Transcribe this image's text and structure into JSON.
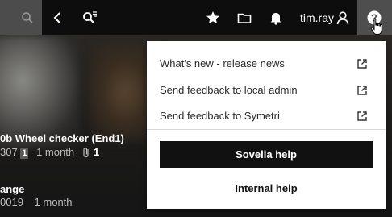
{
  "topbar": {
    "username": "tim.ray"
  },
  "icons": {
    "search": "search-icon",
    "back": "chevron-left-icon",
    "advanced_search": "advanced-search-icon",
    "favorites": "star-icon",
    "folder": "folder-icon",
    "notifications": "bell-icon",
    "user": "user-icon",
    "help": "help-icon"
  },
  "colors": {
    "topbar": "#0d0d0d",
    "menu_background": "#ffffff",
    "primary_button": "#111111"
  },
  "items": [
    {
      "title": "0b Wheel checker (End1)",
      "code": "307",
      "version": "1",
      "age": "1 month",
      "attachments": "1"
    },
    {
      "title": "ange",
      "code": "0019",
      "age": "1 month"
    }
  ],
  "help_menu": {
    "links": [
      {
        "label": "What's new - release news"
      },
      {
        "label": "Send feedback to local admin"
      },
      {
        "label": "Send feedback to Symetri"
      }
    ],
    "primary_button": "Sovelia help",
    "secondary_button": "Internal help"
  }
}
